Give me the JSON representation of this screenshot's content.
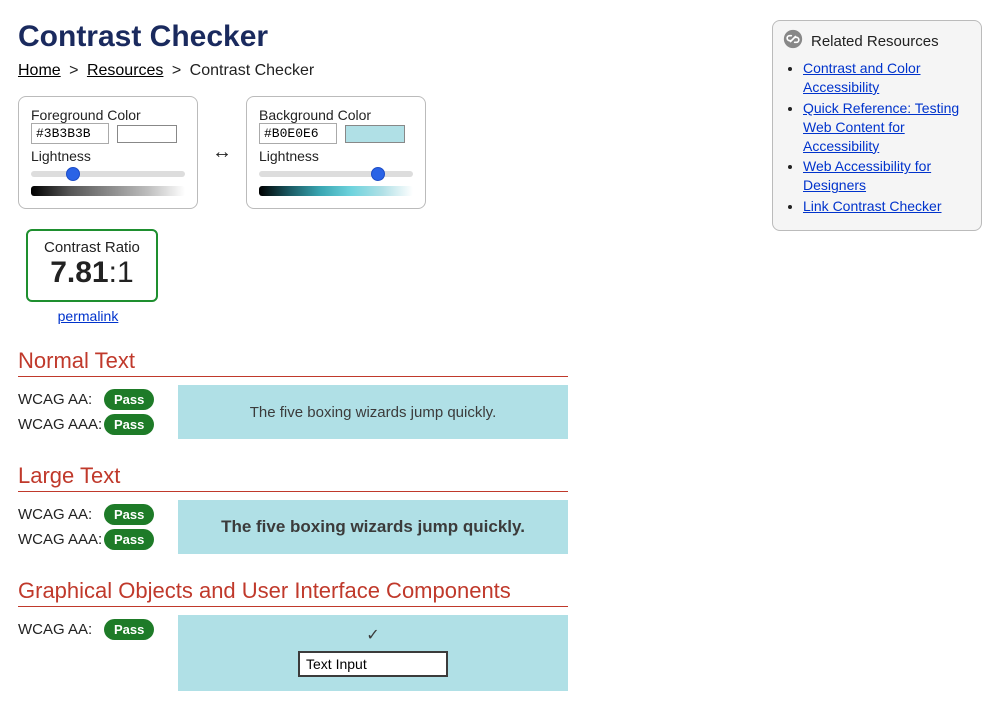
{
  "title": "Contrast Checker",
  "breadcrumb": {
    "home": "Home",
    "resources": "Resources",
    "current": "Contrast Checker",
    "sep": ">"
  },
  "fg": {
    "legend": "Foreground Color",
    "hex": "#3B3B3B",
    "lightness_label": "Lightness",
    "lightness_value": 25,
    "swatch": "#3b3b3b",
    "hue_gradient": "linear-gradient(to right,#000,#555,#888,#bbb,#fff)"
  },
  "bg": {
    "legend": "Background Color",
    "hex": "#B0E0E6",
    "lightness_label": "Lightness",
    "lightness_value": 80,
    "swatch": "#b0e0e6",
    "hue_gradient": "linear-gradient(to right,#000,#1a5a63,#3aa7b3,#6ed3dd,#b0e0e6,#fff)"
  },
  "swap_glyph": "↔",
  "ratio": {
    "label": "Contrast Ratio",
    "value": "7.81",
    "denom": ":1",
    "permalink": "permalink"
  },
  "sections": {
    "normal": {
      "heading": "Normal Text",
      "aa_label": "WCAG AA:",
      "aa_result": "Pass",
      "aaa_label": "WCAG AAA:",
      "aaa_result": "Pass",
      "sample": "The five boxing wizards jump quickly."
    },
    "large": {
      "heading": "Large Text",
      "aa_label": "WCAG AA:",
      "aa_result": "Pass",
      "aaa_label": "WCAG AAA:",
      "aaa_result": "Pass",
      "sample": "The five boxing wizards jump quickly."
    },
    "ui": {
      "heading": "Graphical Objects and User Interface Components",
      "aa_label": "WCAG AA:",
      "aa_result": "Pass",
      "check_glyph": "✓",
      "input_value": "Text Input"
    }
  },
  "related": {
    "heading": "Related Resources",
    "items": [
      "Contrast and Color Accessibility",
      "Quick Reference: Testing Web Content for Accessibility",
      "Web Accessibility for Designers",
      "Link Contrast Checker"
    ]
  }
}
